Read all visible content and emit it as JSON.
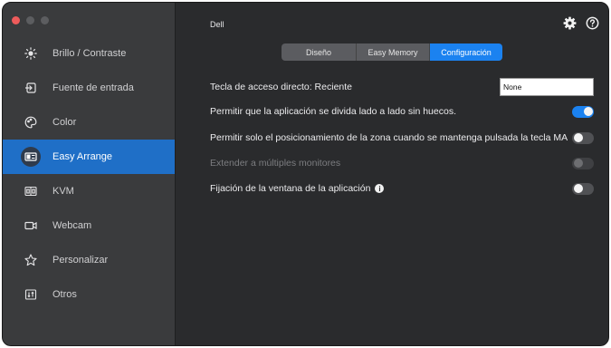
{
  "app": {
    "title": "Dell"
  },
  "colors": {
    "accent": "#1b82f0",
    "sidebar_active": "#1f6fc7"
  },
  "header": {
    "settings_icon": "gear-icon",
    "help_icon": "help-icon"
  },
  "sidebar": {
    "items": [
      {
        "label": "Brillo / Contraste",
        "icon": "brightness-icon"
      },
      {
        "label": "Fuente de entrada",
        "icon": "input-source-icon"
      },
      {
        "label": "Color",
        "icon": "palette-icon"
      },
      {
        "label": "Easy Arrange",
        "icon": "easy-arrange-icon",
        "active": true
      },
      {
        "label": "KVM",
        "icon": "kvm-icon"
      },
      {
        "label": "Webcam",
        "icon": "webcam-icon"
      },
      {
        "label": "Personalizar",
        "icon": "star-icon"
      },
      {
        "label": "Otros",
        "icon": "others-icon"
      }
    ]
  },
  "tabs": [
    {
      "label": "Diseño",
      "active": false
    },
    {
      "label": "Easy Memory",
      "active": false
    },
    {
      "label": "Configuración",
      "active": true
    }
  ],
  "settings": {
    "hotkey": {
      "label": "Tecla de acceso directo: Reciente",
      "value": "None"
    },
    "split_no_gaps": {
      "label": "Permitir que la aplicación se divida lado a lado sin huecos.",
      "on": true
    },
    "zone_shift": {
      "label": "Permitir solo el posicionamiento de la zona cuando se mantenga pulsada la tecla MA",
      "on": false
    },
    "extend_monitors": {
      "label": "Extender a múltiples monitores",
      "on": false,
      "disabled": true
    },
    "pin_window": {
      "label": "Fijación de la ventana de la aplicación",
      "info": "i",
      "on": false
    }
  }
}
